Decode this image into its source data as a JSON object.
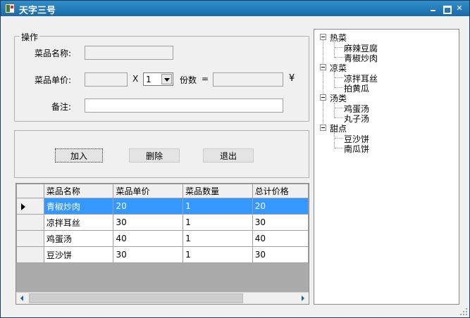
{
  "window": {
    "title": "天字三号"
  },
  "operations": {
    "legend": "操作",
    "dish_name_label": "菜品名称:",
    "dish_name_value": "",
    "unit_price_label": "菜品单价:",
    "unit_price_value": "",
    "multiply_sign": "X",
    "quantity_value": "1",
    "portions_label": "份数",
    "equals_sign": "=",
    "total_value": "",
    "currency_symbol": "¥",
    "note_label": "备注:",
    "note_value": ""
  },
  "actions": {
    "add_label": "加入",
    "delete_label": "删除",
    "exit_label": "退出"
  },
  "grid": {
    "columns": [
      "菜品名称",
      "菜品单价",
      "菜品数量",
      "总计价格"
    ],
    "rows": [
      [
        "青椒炒肉",
        "20",
        "1",
        "20"
      ],
      [
        "凉拌耳丝",
        "30",
        "1",
        "30"
      ],
      [
        "鸡蛋汤",
        "40",
        "1",
        "40"
      ],
      [
        "豆沙饼",
        "30",
        "1",
        "30"
      ]
    ],
    "selected_row": 0
  },
  "menu_tree": {
    "categories": [
      {
        "label": "热菜",
        "items": [
          "麻辣豆腐",
          "青椒炒肉"
        ]
      },
      {
        "label": "凉菜",
        "items": [
          "凉拌耳丝",
          "拍黄瓜"
        ]
      },
      {
        "label": "汤类",
        "items": [
          "鸡蛋汤",
          "丸子汤"
        ]
      },
      {
        "label": "甜点",
        "items": [
          "豆沙饼",
          "南瓜饼"
        ]
      }
    ]
  },
  "colors": {
    "titlebar": "#1a6aa8",
    "selection": "#3399ff"
  }
}
